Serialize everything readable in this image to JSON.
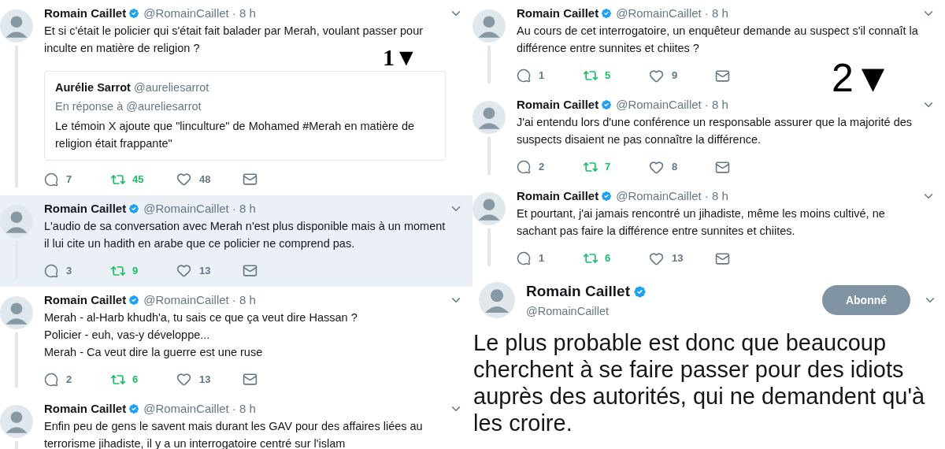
{
  "columns": [
    {
      "annotation": {
        "text": "1▼",
        "bold": true
      },
      "tweets": [
        {
          "name": "Romain Caillet",
          "handle": "@RomainCaillet",
          "time": "· 8 h",
          "highlighted": false,
          "lines": [
            "Et si c'était le policier qui s'était fait balader par Merah, voulant passer pour inculte en matière de religion ?"
          ],
          "quote": {
            "name": "Aurélie Sarrot",
            "handle": "@aureliesarrot",
            "reply_to": "En réponse à @aureliesarrot",
            "text": "Le témoin X ajoute que \"linculture\" de Mohamed #Merah en matière de religion était frappante\""
          },
          "replies": "7",
          "retweets": "45",
          "likes": "48",
          "retweeted": true
        },
        {
          "name": "Romain Caillet",
          "handle": "@RomainCaillet",
          "time": "· 8 h",
          "highlighted": true,
          "lines": [
            "L'audio de sa conversation avec Merah n'est plus disponible mais à un moment il lui cite un hadith en arabe que ce policier ne comprend pas."
          ],
          "replies": "3",
          "retweets": "9",
          "likes": "13",
          "retweeted": true
        },
        {
          "name": "Romain Caillet",
          "handle": "@RomainCaillet",
          "time": "· 8 h",
          "highlighted": false,
          "lines": [
            "Merah - al-Harb khudh'a, tu sais ce que ça veut dire Hassan ?",
            "Policier - euh, vas-y développe...",
            "Merah - Ca veut dire la guerre est une ruse"
          ],
          "replies": "2",
          "retweets": "6",
          "likes": "13",
          "retweeted": true
        },
        {
          "name": "Romain Caillet",
          "handle": "@RomainCaillet",
          "time": "· 8 h",
          "highlighted": false,
          "lines": [
            "Enfin peu de gens le savent mais durant les GAV pour des affaires liées au terrorisme jihadiste, il y a un interrogatoire centré sur l'islam"
          ]
        }
      ]
    },
    {
      "annotation": {
        "text": "2▼",
        "bold": false
      },
      "tweets": [
        {
          "name": "Romain Caillet",
          "handle": "@RomainCaillet",
          "time": "· 8 h",
          "highlighted": false,
          "lines": [
            "Au cours de cet interrogatoire, un enquêteur demande au suspect s'il connaît la différence entre sunnites et chiites ?"
          ],
          "replies": "1",
          "retweets": "5",
          "likes": "9",
          "retweeted": true
        },
        {
          "name": "Romain Caillet",
          "handle": "@RomainCaillet",
          "time": "· 8 h",
          "highlighted": false,
          "lines": [
            "J'ai entendu lors d'une conférence un responsable assurer que la majorité des suspects disaient ne pas connaître la différence."
          ],
          "replies": "2",
          "retweets": "7",
          "likes": "8",
          "retweeted": true
        },
        {
          "name": "Romain Caillet",
          "handle": "@RomainCaillet",
          "time": "· 8 h",
          "highlighted": false,
          "lines": [
            "Et pourtant, j'ai jamais rencontré un jihadiste, même les moins cultivé, ne sachant pas faire la différence entre sunnites et chiites."
          ],
          "replies": "1",
          "retweets": "6",
          "likes": "13",
          "retweeted": true
        }
      ],
      "featured": {
        "name": "Romain Caillet",
        "handle": "@RomainCaillet",
        "follow_button": "Abonné",
        "text": "Le plus probable est donc que beaucoup cherchent à se faire passer pour des idiots auprès des autorités, qui ne demandent qu'à les croire."
      }
    }
  ]
}
